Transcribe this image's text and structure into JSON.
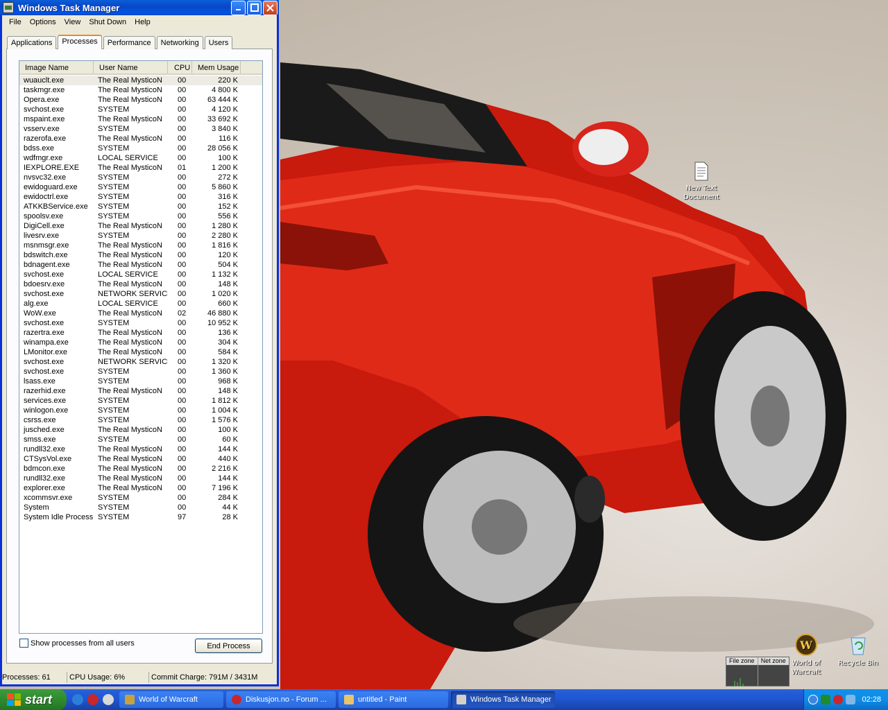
{
  "window": {
    "title": "Windows Task Manager",
    "menu": [
      "File",
      "Options",
      "View",
      "Shut Down",
      "Help"
    ],
    "tabs": [
      "Applications",
      "Processes",
      "Performance",
      "Networking",
      "Users"
    ],
    "active_tab": "Processes",
    "columns": [
      "Image Name",
      "User Name",
      "CPU",
      "Mem Usage"
    ],
    "processes": [
      [
        "wuauclt.exe",
        "The Real MysticoN",
        "00",
        "220 K"
      ],
      [
        "taskmgr.exe",
        "The Real MysticoN",
        "00",
        "4 800 K"
      ],
      [
        "Opera.exe",
        "The Real MysticoN",
        "00",
        "63 444 K"
      ],
      [
        "svchost.exe",
        "SYSTEM",
        "00",
        "4 120 K"
      ],
      [
        "mspaint.exe",
        "The Real MysticoN",
        "00",
        "33 692 K"
      ],
      [
        "vsserv.exe",
        "SYSTEM",
        "00",
        "3 840 K"
      ],
      [
        "razerofa.exe",
        "The Real MysticoN",
        "00",
        "116 K"
      ],
      [
        "bdss.exe",
        "SYSTEM",
        "00",
        "28 056 K"
      ],
      [
        "wdfmgr.exe",
        "LOCAL SERVICE",
        "00",
        "100 K"
      ],
      [
        "IEXPLORE.EXE",
        "The Real MysticoN",
        "01",
        "1 200 K"
      ],
      [
        "nvsvc32.exe",
        "SYSTEM",
        "00",
        "272 K"
      ],
      [
        "ewidoguard.exe",
        "SYSTEM",
        "00",
        "5 860 K"
      ],
      [
        "ewidoctrl.exe",
        "SYSTEM",
        "00",
        "316 K"
      ],
      [
        "ATKKBService.exe",
        "SYSTEM",
        "00",
        "152 K"
      ],
      [
        "spoolsv.exe",
        "SYSTEM",
        "00",
        "556 K"
      ],
      [
        "DigiCell.exe",
        "The Real MysticoN",
        "00",
        "1 280 K"
      ],
      [
        "livesrv.exe",
        "SYSTEM",
        "00",
        "2 280 K"
      ],
      [
        "msnmsgr.exe",
        "The Real MysticoN",
        "00",
        "1 816 K"
      ],
      [
        "bdswitch.exe",
        "The Real MysticoN",
        "00",
        "120 K"
      ],
      [
        "bdnagent.exe",
        "The Real MysticoN",
        "00",
        "504 K"
      ],
      [
        "svchost.exe",
        "LOCAL SERVICE",
        "00",
        "1 132 K"
      ],
      [
        "bdoesrv.exe",
        "The Real MysticoN",
        "00",
        "148 K"
      ],
      [
        "svchost.exe",
        "NETWORK SERVICE",
        "00",
        "1 020 K"
      ],
      [
        "alg.exe",
        "LOCAL SERVICE",
        "00",
        "660 K"
      ],
      [
        "WoW.exe",
        "The Real MysticoN",
        "02",
        "46 880 K"
      ],
      [
        "svchost.exe",
        "SYSTEM",
        "00",
        "10 952 K"
      ],
      [
        "razertra.exe",
        "The Real MysticoN",
        "00",
        "136 K"
      ],
      [
        "winampa.exe",
        "The Real MysticoN",
        "00",
        "304 K"
      ],
      [
        "LMonitor.exe",
        "The Real MysticoN",
        "00",
        "584 K"
      ],
      [
        "svchost.exe",
        "NETWORK SERVICE",
        "00",
        "1 320 K"
      ],
      [
        "svchost.exe",
        "SYSTEM",
        "00",
        "1 360 K"
      ],
      [
        "lsass.exe",
        "SYSTEM",
        "00",
        "968 K"
      ],
      [
        "razerhid.exe",
        "The Real MysticoN",
        "00",
        "148 K"
      ],
      [
        "services.exe",
        "SYSTEM",
        "00",
        "1 812 K"
      ],
      [
        "winlogon.exe",
        "SYSTEM",
        "00",
        "1 004 K"
      ],
      [
        "csrss.exe",
        "SYSTEM",
        "00",
        "1 576 K"
      ],
      [
        "jusched.exe",
        "The Real MysticoN",
        "00",
        "100 K"
      ],
      [
        "smss.exe",
        "SYSTEM",
        "00",
        "60 K"
      ],
      [
        "rundll32.exe",
        "The Real MysticoN",
        "00",
        "144 K"
      ],
      [
        "CTSysVol.exe",
        "The Real MysticoN",
        "00",
        "440 K"
      ],
      [
        "bdmcon.exe",
        "The Real MysticoN",
        "00",
        "2 216 K"
      ],
      [
        "rundll32.exe",
        "The Real MysticoN",
        "00",
        "144 K"
      ],
      [
        "explorer.exe",
        "The Real MysticoN",
        "00",
        "7 196 K"
      ],
      [
        "xcommsvr.exe",
        "SYSTEM",
        "00",
        "284 K"
      ],
      [
        "System",
        "SYSTEM",
        "00",
        "44 K"
      ],
      [
        "System Idle Process",
        "SYSTEM",
        "97",
        "28 K"
      ]
    ],
    "show_all_label": "Show processes from all users",
    "end_process_label": "End Process",
    "status": {
      "processes": "Processes: 61",
      "cpu": "CPU Usage: 6%",
      "commit": "Commit Charge: 791M / 3431M"
    }
  },
  "desktop": {
    "icons": {
      "text_doc": "New Text Document",
      "wow": "World of Warcraft",
      "recycle": "Recycle Bin"
    },
    "widget": {
      "file_zone": "File zone",
      "net_zone": "Net zone"
    }
  },
  "taskbar": {
    "start_label": "start",
    "tasks": [
      "World of Warcraft",
      "Diskusjon.no - Forum ...",
      "untitled - Paint",
      "Windows Task Manager"
    ],
    "active_task": "Windows Task Manager",
    "clock": "02:28"
  },
  "colors": {
    "xp_blue": "#0054e3",
    "start_green": "#2f8a2f",
    "car_red": "#d01f10"
  }
}
